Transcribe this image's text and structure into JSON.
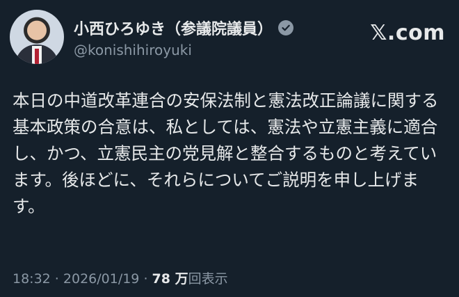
{
  "author": {
    "display_name": "小西ひろゆき（参議院議員）",
    "handle": "@konishihiroyuki"
  },
  "brand": {
    "logo_text": "𝕏.com"
  },
  "post": {
    "text": "本日の中道改革連合の安保法制と憲法改正論議に関する基本政策の合意は、私としては、憲法や立憲主義に適合し、かつ、立憲民主の党見解と整合するものと考えています。後ほどに、それらについてご説明を申し上げます。"
  },
  "meta": {
    "time": "18:32",
    "separator": " · ",
    "date": "2026/01/19",
    "views_count": "78 万",
    "views_label": "回表示"
  },
  "icons": {
    "verified": "verified-badge-icon"
  },
  "colors": {
    "background": "#15202b",
    "text_primary": "#e7e9ea",
    "text_secondary": "#8b98a5"
  }
}
